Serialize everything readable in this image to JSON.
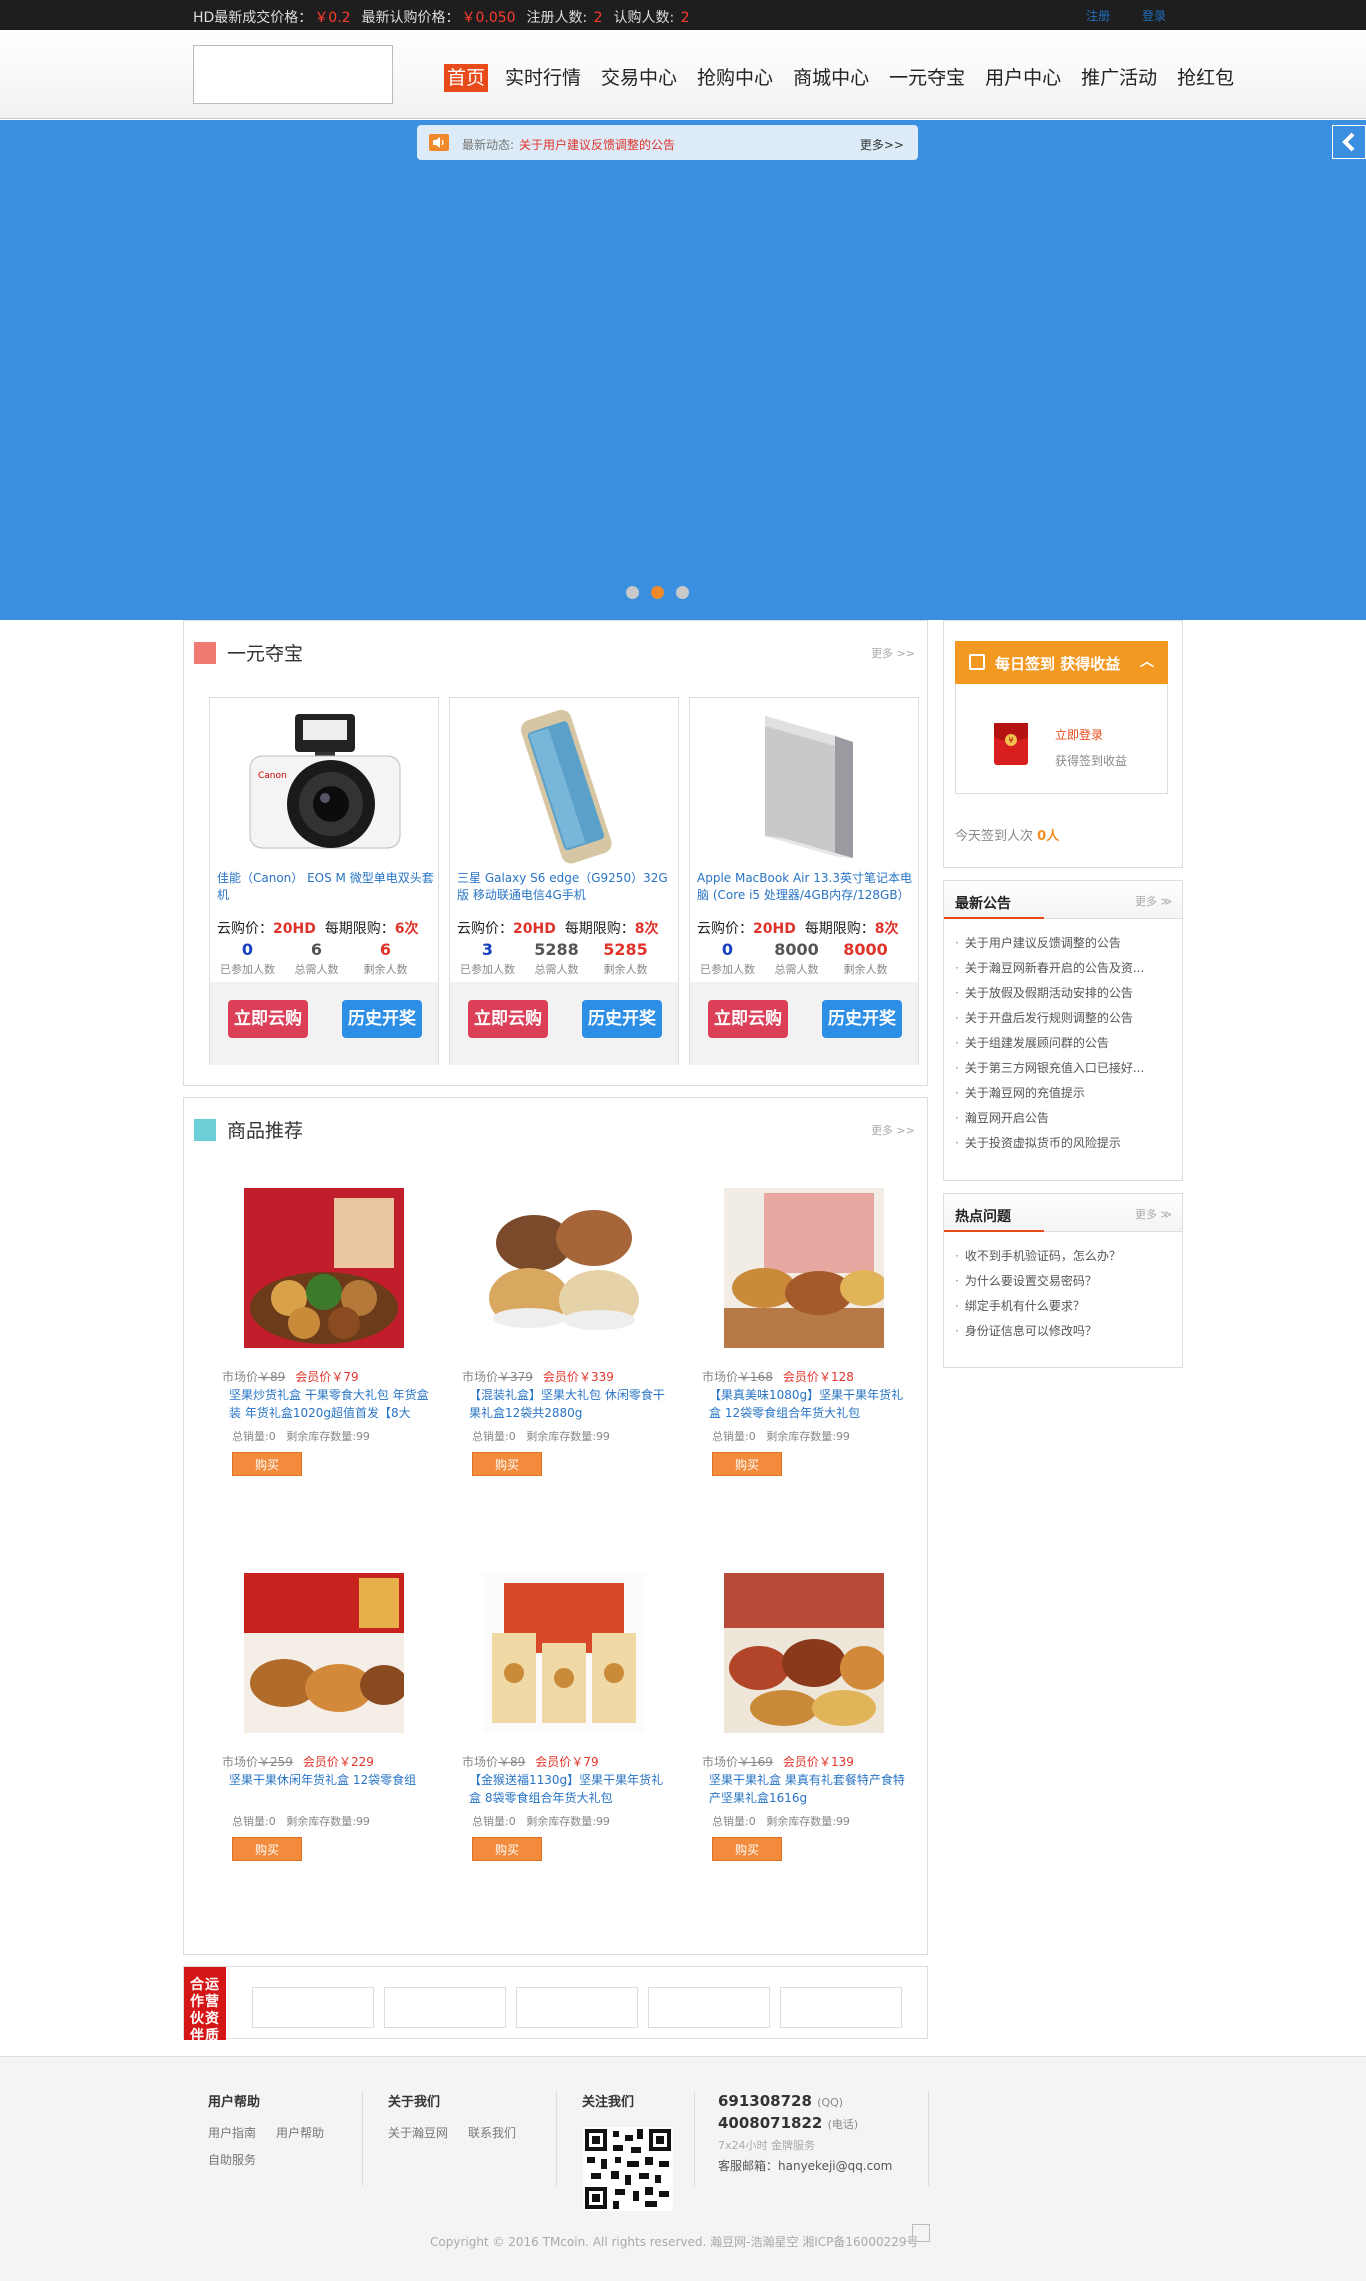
{
  "topbar": {
    "last_price_label": "HD最新成交价格：",
    "last_price": "￥0.2",
    "buy_price_label": "最新认购价格：",
    "buy_price": "￥0.050",
    "reg_label": "注册人数: ",
    "reg_count": "2",
    "sub_label": "认购人数: ",
    "sub_count": "2",
    "register": "注册",
    "login": "登录"
  },
  "nav": [
    "首页",
    "实时行情",
    "交易中心",
    "抢购中心",
    "商城中心",
    "一元夺宝",
    "用户中心",
    "推广活动",
    "抢红包"
  ],
  "notice": {
    "label": "最新动态:",
    "message": "关于用户建议反馈调整的公告",
    "more": "更多>>"
  },
  "treasure": {
    "title": "一元夺宝",
    "more": "更多 >>",
    "price_label": "云购价：",
    "limit_label": "每期限购：",
    "stat_labels": [
      "已参加人数",
      "总需人数",
      "剩余人数"
    ],
    "buy_button": "立即云购",
    "history_button": "历史开奖",
    "items": [
      {
        "title": "佳能（Canon） EOS M 微型单电双头套机",
        "price": "20HD",
        "limit": "6次",
        "joined": "0",
        "total": "6",
        "left": "6",
        "icon": "camera-image"
      },
      {
        "title": "三星 Galaxy S6 edge（G9250）32G版 移动联通电信4G手机",
        "price": "20HD",
        "limit": "8次",
        "joined": "3",
        "total": "5288",
        "left": "5285",
        "icon": "phone-image"
      },
      {
        "title": "Apple MacBook Air 13.3英寸笔记本电脑 (Core i5 处理器/4GB内存/128GB）",
        "price": "20HD",
        "limit": "8次",
        "joined": "0",
        "total": "8000",
        "left": "8000",
        "icon": "laptop-image"
      }
    ]
  },
  "products": {
    "title": "商品推荐",
    "more": "更多 >>",
    "market_label": "市场价",
    "member_label": "会员价",
    "sold_label": "总销量:",
    "stock_label": "剩余库存数量:",
    "buy_label": "购买",
    "items": [
      {
        "market": "￥89",
        "member": "￥79",
        "name": "坚果炒货礼盒 干果零食大礼包 年货盒装 年货礼盒1020g超值首发【8大",
        "sold": "0",
        "stock": "99"
      },
      {
        "market": "￥379",
        "member": "￥339",
        "name": "【混装礼盒】坚果大礼包 休闲零食干果礼盒12袋共2880g",
        "sold": "0",
        "stock": "99"
      },
      {
        "market": "￥168",
        "member": "￥128",
        "name": "【果真美味1080g】坚果干果年货礼盒 12袋零食组合年货大礼包",
        "sold": "0",
        "stock": "99"
      },
      {
        "market": "￥259",
        "member": "￥229",
        "name": "坚果干果休闲年货礼盒 12袋零食组",
        "sold": "0",
        "stock": "99"
      },
      {
        "market": "￥89",
        "member": "￥79",
        "name": "【金猴送福1130g】坚果干果年货礼盒 8袋零食组合年货大礼包",
        "sold": "0",
        "stock": "99"
      },
      {
        "market": "￥169",
        "member": "￥139",
        "name": "坚果干果礼盒 果真有礼套餐特产食特产坚果礼盒1616g",
        "sold": "0",
        "stock": "99"
      }
    ]
  },
  "signin": {
    "title": "每日签到 获得收益",
    "login": "立即登录",
    "earn": "获得签到收益",
    "today_label": "今天签到人次",
    "today_count": "0人"
  },
  "announcements": {
    "title": "最新公告",
    "more": "更多",
    "items": [
      "关于用户建议反馈调整的公告",
      "关于瀚豆网新春开启的公告及资...",
      "关于放假及假期活动安排的公告",
      "关于开盘后发行规则调整的公告",
      "关于组建发展顾问群的公告",
      "关于第三方网银充值入口已接好...",
      "关于瀚豆网的充值提示",
      "瀚豆网开启公告",
      "关于投资虚拟货币的风险提示"
    ]
  },
  "faq": {
    "title": "热点问题",
    "more": "更多",
    "items": [
      "收不到手机验证码，怎么办？",
      "为什么要设置交易密码？",
      "绑定手机有什么要求？",
      "身份证信息可以修改吗？"
    ]
  },
  "partners": {
    "label_col1": "运营资质",
    "label_col2": "合作伙伴"
  },
  "footer": {
    "help_title": "用户帮助",
    "help_links": [
      "用户指南",
      "用户帮助"
    ],
    "help_link3": "自助服务",
    "about_title": "关于我们",
    "about_links": [
      "关于瀚豆网",
      "联系我们"
    ],
    "follow_title": "关注我们",
    "qq": "691308728",
    "qq_label": "(QQ)",
    "phone": "4008071822",
    "phone_label": "(电话)",
    "service": "7x24小时 金牌服务",
    "email": "客服邮箱：hanyekeji@qq.com",
    "copyright": "Copyright © 2016 TMcoin. All rights reserved. 瀚豆网-浩瀚星空 湘ICP备16000229号"
  },
  "colors": {
    "accent": "#e84a1a",
    "banner": "#3a8fe0",
    "price_red": "#e0342b",
    "sign_orange": "#f39821",
    "partner_red": "#d51616"
  }
}
